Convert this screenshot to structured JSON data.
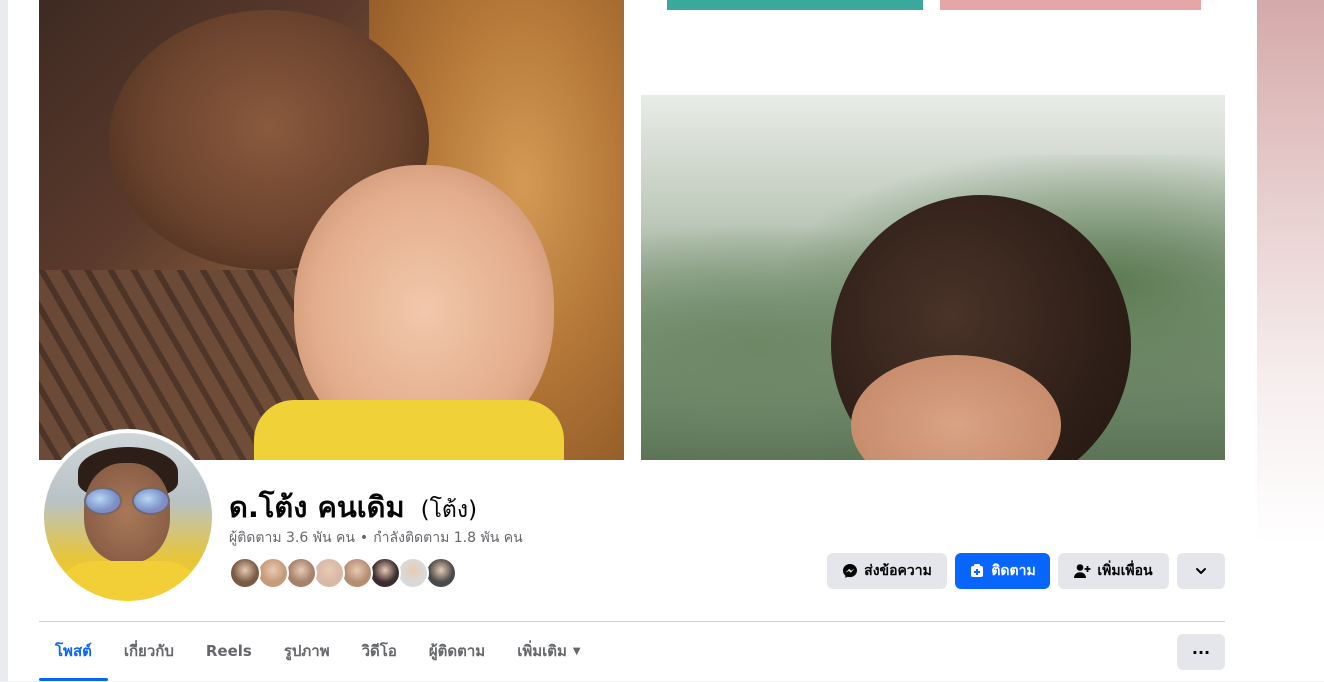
{
  "profile": {
    "name": "ด.โต้ง คนเดิม",
    "alternate_name": "(โต้ง)",
    "followers": "ผู้ติดตาม 3.6 พัน คน",
    "separator": "•",
    "following": "กำลังติดตาม 1.8 พัน คน"
  },
  "friends_preview": {
    "colors": [
      "#7a5a44",
      "#c79a7a",
      "#a5806a",
      "#d8b8a6",
      "#b58d73",
      "#3b2d2f",
      "#d9d9d9",
      "#4a4a4a"
    ]
  },
  "actions": {
    "message_label": "ส่งข้อความ",
    "follow_label": "ติดตาม",
    "add_friend_label": "เพิ่มเพื่อน",
    "more_icon": "chevron-down-icon"
  },
  "tabs": [
    {
      "label": "โพสต์",
      "active": true
    },
    {
      "label": "เกี่ยวกับ"
    },
    {
      "label": "Reels"
    },
    {
      "label": "รูปภาพ"
    },
    {
      "label": "วิดีโอ"
    },
    {
      "label": "ผู้ติดตาม"
    },
    {
      "label": "เพิ่มเติม",
      "caret": "▼"
    }
  ],
  "tabs_more_label": "···",
  "colors": {
    "accent": "#0866ff",
    "button_gray": "#e4e6eb",
    "text_primary": "#050505",
    "text_secondary": "#65676b"
  }
}
